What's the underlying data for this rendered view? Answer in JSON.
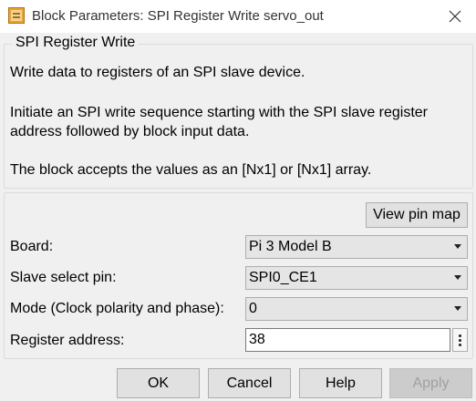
{
  "window": {
    "title": "Block Parameters: SPI Register Write servo_out",
    "app_icon": "block-parameters-icon"
  },
  "description": {
    "heading": "SPI Register Write",
    "line1": "Write data to registers of an SPI slave device.",
    "line2": "Initiate an SPI write sequence starting with the SPI slave register",
    "line3": "address followed by block input data.",
    "line4": "The block accepts the values as an [Nx1] or [Nx1] array."
  },
  "parameters": {
    "view_pin_map_label": "View pin map",
    "board": {
      "label": "Board:",
      "value": "Pi 3 Model B"
    },
    "slave_select": {
      "label": "Slave select pin:",
      "value": "SPI0_CE1"
    },
    "mode": {
      "label": "Mode (Clock polarity and phase):",
      "value": "0"
    },
    "register_address": {
      "label": "Register address:",
      "value": "38"
    }
  },
  "buttons": {
    "ok": "OK",
    "cancel": "Cancel",
    "help": "Help",
    "apply": "Apply"
  }
}
